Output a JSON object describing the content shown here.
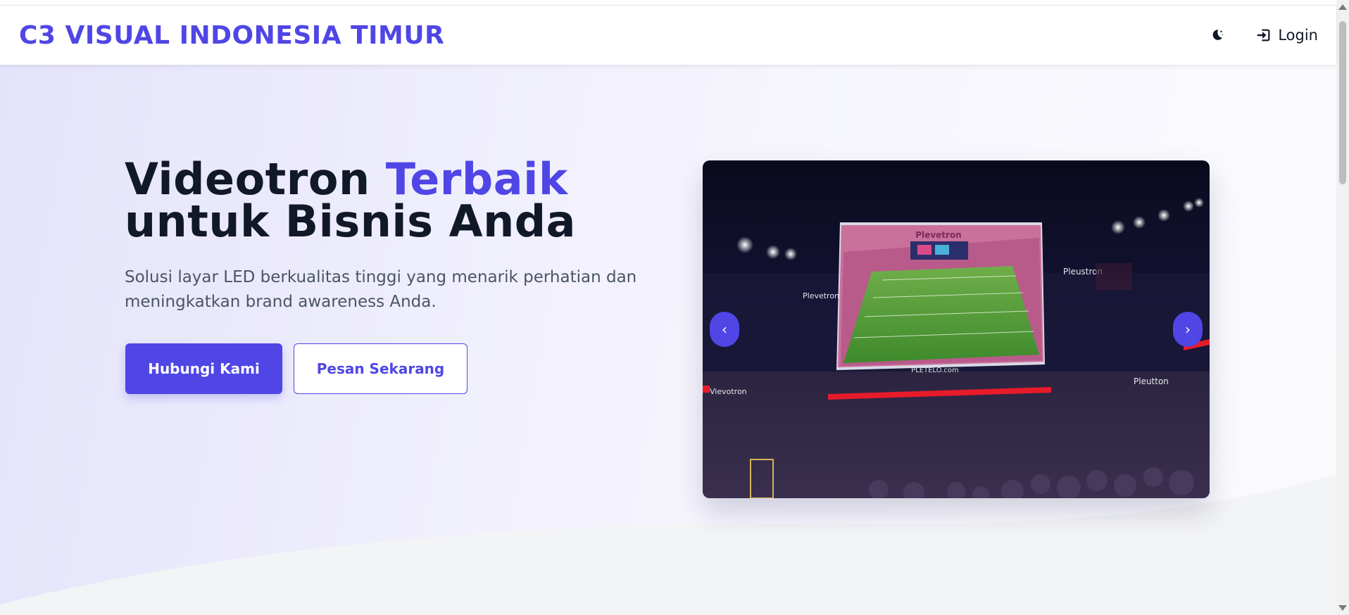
{
  "header": {
    "brand": "C3 VISUAL INDONESIA TIMUR",
    "theme_toggle_icon": "moon-stars-icon",
    "login_icon": "sign-in-icon",
    "login_label": "Login"
  },
  "hero": {
    "title_part1": "Videotron ",
    "title_accent": "Terbaik",
    "title_line2": "untuk Bisnis Anda",
    "subtitle": "Solusi layar LED berkualitas tinggi yang menarik perhatian dan meningkatkan brand awareness Anda.",
    "primary_button": "Hubungi Kami",
    "secondary_button": "Pesan Sekarang"
  },
  "carousel": {
    "prev_icon": "chevron-left-icon",
    "next_icon": "chevron-right-icon",
    "prev_symbol": "‹",
    "next_symbol": "›",
    "screen_label": "Plevetron",
    "screen_url": "PLETELO.com",
    "sign_left": "Plevetron",
    "sign_right": "Pleustron",
    "sign_left_low": "Vievotron",
    "sign_right_low": "Pleutton"
  },
  "colors": {
    "accent": "#4f46e5",
    "text_dark": "#111827",
    "text_muted": "#4b5563"
  }
}
